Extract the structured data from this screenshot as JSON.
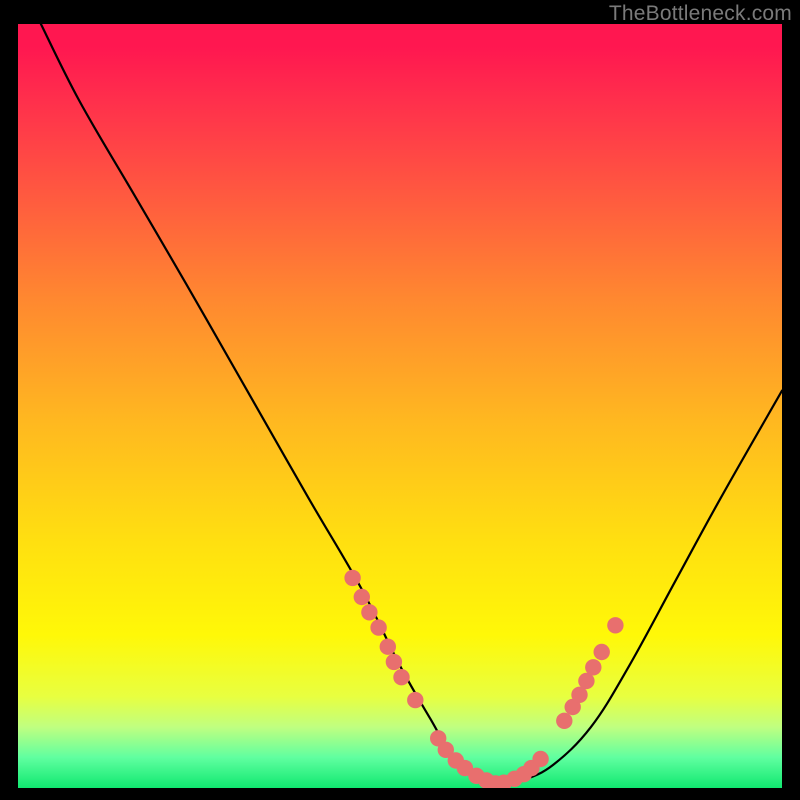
{
  "watermark": "TheBottleneck.com",
  "chart_data": {
    "type": "line",
    "title": "",
    "xlabel": "",
    "ylabel": "",
    "ylim": [
      0,
      100
    ],
    "xlim": [
      0,
      100
    ],
    "curve": {
      "name": "bottleneck-curve",
      "x": [
        3,
        8,
        15,
        22,
        30,
        38,
        45,
        50,
        54,
        57,
        60,
        63,
        66,
        70,
        75,
        80,
        86,
        92,
        100
      ],
      "y": [
        100,
        90,
        78,
        66,
        52,
        38,
        26,
        16,
        9,
        4,
        1.5,
        0.5,
        1,
        3,
        8,
        16,
        27,
        38,
        52
      ]
    },
    "marker_clusters": [
      {
        "name": "left-slope-dots",
        "points": [
          [
            43.8,
            27.5
          ],
          [
            45.0,
            25.0
          ],
          [
            46.0,
            23.0
          ],
          [
            47.2,
            21.0
          ],
          [
            48.4,
            18.5
          ],
          [
            49.2,
            16.5
          ],
          [
            50.2,
            14.5
          ],
          [
            52.0,
            11.5
          ]
        ]
      },
      {
        "name": "valley-dots",
        "points": [
          [
            55.0,
            6.5
          ],
          [
            56.0,
            5.0
          ],
          [
            57.3,
            3.6
          ],
          [
            58.5,
            2.6
          ],
          [
            60.0,
            1.6
          ],
          [
            61.3,
            1.0
          ],
          [
            62.5,
            0.6
          ],
          [
            63.6,
            0.7
          ],
          [
            65.0,
            1.2
          ],
          [
            66.2,
            1.8
          ],
          [
            67.2,
            2.6
          ],
          [
            68.4,
            3.8
          ]
        ]
      },
      {
        "name": "right-slope-dots",
        "points": [
          [
            71.5,
            8.8
          ],
          [
            72.6,
            10.6
          ],
          [
            73.5,
            12.2
          ],
          [
            74.4,
            14.0
          ],
          [
            75.3,
            15.8
          ],
          [
            76.4,
            17.8
          ],
          [
            78.2,
            21.3
          ]
        ]
      }
    ],
    "colors": {
      "curve": "#000000",
      "dots": "#e86f6e",
      "gradient_top": "#ff1750",
      "gradient_bottom": "#10e870"
    }
  }
}
